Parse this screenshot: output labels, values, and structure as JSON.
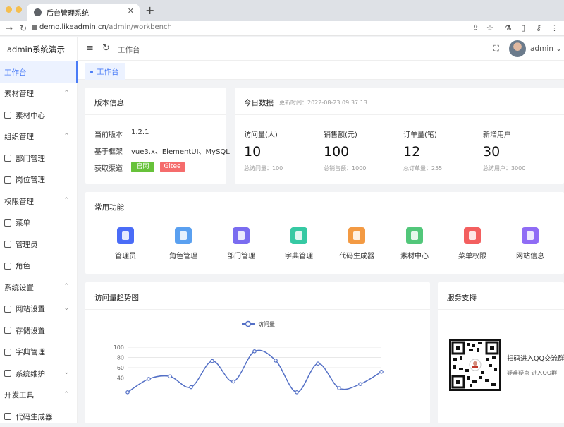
{
  "browser": {
    "tab_title": "后台管理系统",
    "url_host": "demo.likeadmin.cn",
    "url_path": "/admin/workbench"
  },
  "sidebar": {
    "logo": "admin系统演示",
    "items": [
      {
        "label": "工作台",
        "type": "active"
      },
      {
        "label": "素材管理",
        "type": "group"
      },
      {
        "label": "素材中心",
        "type": "sub"
      },
      {
        "label": "组织管理",
        "type": "group"
      },
      {
        "label": "部门管理",
        "type": "sub"
      },
      {
        "label": "岗位管理",
        "type": "sub"
      },
      {
        "label": "权限管理",
        "type": "group"
      },
      {
        "label": "菜单",
        "type": "sub"
      },
      {
        "label": "管理员",
        "type": "sub"
      },
      {
        "label": "角色",
        "type": "sub"
      },
      {
        "label": "系统设置",
        "type": "group"
      },
      {
        "label": "网站设置",
        "type": "sub-expand"
      },
      {
        "label": "存储设置",
        "type": "sub"
      },
      {
        "label": "字典管理",
        "type": "sub"
      },
      {
        "label": "系统维护",
        "type": "sub-expand"
      },
      {
        "label": "开发工具",
        "type": "group"
      },
      {
        "label": "代码生成器",
        "type": "sub"
      }
    ]
  },
  "header": {
    "breadcrumb": "工作台",
    "username": "admin",
    "active_tag": "工作台"
  },
  "version_card": {
    "title": "版本信息",
    "rows": [
      {
        "key": "当前版本",
        "value": "1.2.1"
      },
      {
        "key": "基于框架",
        "value": "vue3.x、ElementUI、MySQL"
      },
      {
        "key": "获取渠道",
        "value": ""
      }
    ],
    "btn_official": "官网",
    "btn_gitee": "Gitee"
  },
  "today_card": {
    "title": "今日数据",
    "updated": "更新时间：2022-08-23 09:37:13",
    "stats": [
      {
        "label": "访问量(人)",
        "value": "10",
        "sub": "总访问量：100"
      },
      {
        "label": "销售额(元)",
        "value": "100",
        "sub": "总销售额：1000"
      },
      {
        "label": "订单量(笔)",
        "value": "12",
        "sub": "总订单量：255"
      },
      {
        "label": "新增用户",
        "value": "30",
        "sub": "总访用户：3000"
      }
    ]
  },
  "features_card": {
    "title": "常用功能",
    "items": [
      {
        "label": "管理员",
        "icon": "admin-icon",
        "color": "#4a6cf7"
      },
      {
        "label": "角色管理",
        "icon": "role-icon",
        "color": "#5aa0f0"
      },
      {
        "label": "部门管理",
        "icon": "department-icon",
        "color": "#7a6cf0"
      },
      {
        "label": "字典管理",
        "icon": "dictionary-icon",
        "color": "#36c9a3"
      },
      {
        "label": "代码生成器",
        "icon": "code-generator-icon",
        "color": "#f39a43"
      },
      {
        "label": "素材中心",
        "icon": "material-icon",
        "color": "#52c77a"
      },
      {
        "label": "菜单权限",
        "icon": "menu-permission-icon",
        "color": "#f35f5f"
      },
      {
        "label": "网站信息",
        "icon": "website-icon",
        "color": "#8f6cf5"
      }
    ]
  },
  "trend_card": {
    "title": "访问量趋势图"
  },
  "chart_data": {
    "type": "line",
    "legend": [
      "访问量"
    ],
    "y_ticks": [
      40,
      60,
      80,
      100
    ],
    "ylim": [
      0,
      100
    ],
    "series": [
      {
        "name": "访问量",
        "color": "#5470c6",
        "values": [
          12,
          38,
          43,
          22,
          73,
          33,
          92,
          74,
          12,
          68,
          20,
          28,
          52
        ]
      }
    ]
  },
  "support_card": {
    "title": "服务支持",
    "qq_title": "扫码进入QQ交流群",
    "qq_sub": "疑难疑点 进入QQ群"
  }
}
